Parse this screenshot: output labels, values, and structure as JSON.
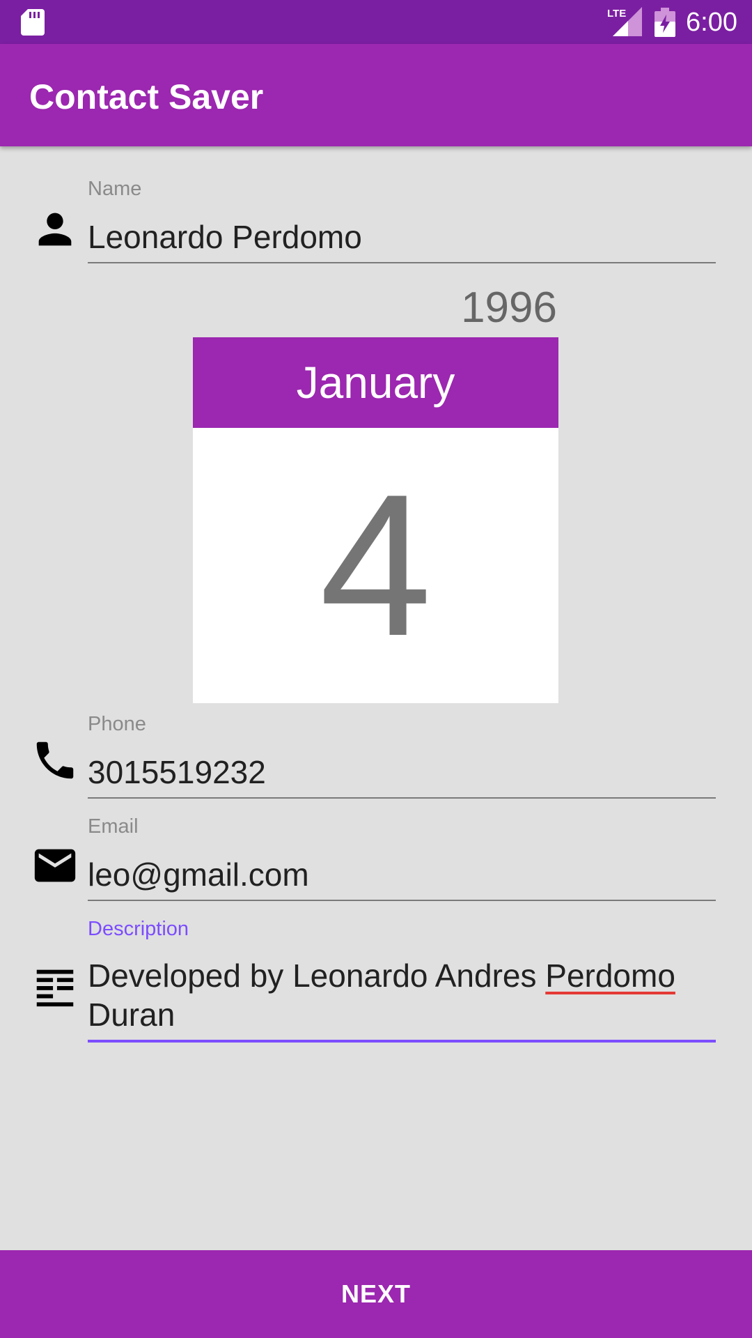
{
  "status_bar": {
    "network_label": "LTE",
    "time": "6:00",
    "icons": [
      "sd-card-icon",
      "lte-signal-icon",
      "battery-charging-icon"
    ]
  },
  "app_bar": {
    "title": "Contact Saver"
  },
  "form": {
    "name": {
      "label": "Name",
      "value": "Leonardo Perdomo",
      "icon": "person-icon"
    },
    "birthdate": {
      "year": "1996",
      "month": "January",
      "day": "4"
    },
    "phone": {
      "label": "Phone",
      "value": "3015519232",
      "icon": "phone-icon"
    },
    "email": {
      "label": "Email",
      "value": "leo@gmail.com",
      "icon": "mail-icon"
    },
    "description": {
      "label": "Description",
      "value_before": "Developed by Leonardo Andres ",
      "value_misspelled": "Perdomo",
      "value_after": " Duran",
      "icon": "description-icon"
    }
  },
  "actions": {
    "next_label": "NEXT"
  },
  "colors": {
    "status_bar": "#7b1fa2",
    "primary": "#9c27b0",
    "accent": "#7c4dff",
    "background": "#e0e0e0",
    "spellcheck": "#e53935"
  }
}
